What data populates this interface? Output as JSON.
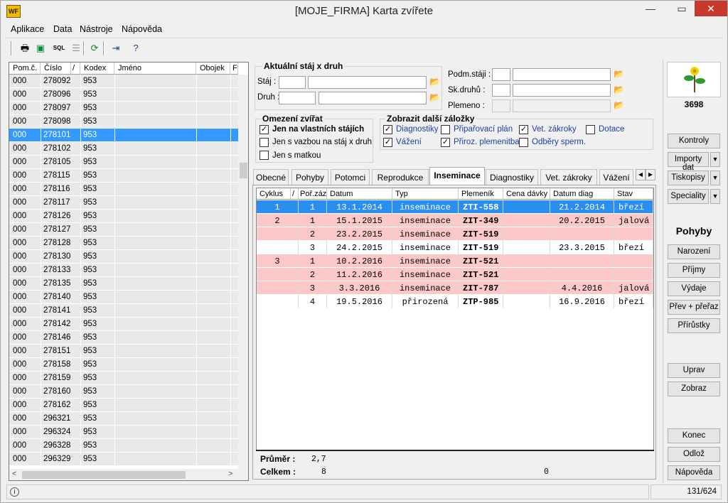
{
  "window": {
    "title": "[MOJE_FIRMA] Karta zvířete",
    "icon_text": "WF"
  },
  "menu": [
    "Aplikace",
    "Data",
    "Nástroje",
    "Nápověda"
  ],
  "toolbar": {
    "icons": [
      "printer-icon",
      "export-icon",
      "sql-icon",
      "columns-icon",
      "refresh-icon",
      "exit-icon",
      "help-icon"
    ],
    "sql_label": "SQL"
  },
  "left_grid": {
    "headers": [
      "Pom.č.",
      "Číslo",
      "/",
      "Kodex",
      "Jméno",
      "Obojek",
      "F"
    ],
    "rows": [
      [
        "000",
        "278092",
        "953"
      ],
      [
        "000",
        "278096",
        "953"
      ],
      [
        "000",
        "278097",
        "953"
      ],
      [
        "000",
        "278098",
        "953"
      ],
      [
        "000",
        "278101",
        "953"
      ],
      [
        "000",
        "278102",
        "953"
      ],
      [
        "000",
        "278105",
        "953"
      ],
      [
        "000",
        "278115",
        "953"
      ],
      [
        "000",
        "278116",
        "953"
      ],
      [
        "000",
        "278117",
        "953"
      ],
      [
        "000",
        "278126",
        "953"
      ],
      [
        "000",
        "278127",
        "953"
      ],
      [
        "000",
        "278128",
        "953"
      ],
      [
        "000",
        "278130",
        "953"
      ],
      [
        "000",
        "278133",
        "953"
      ],
      [
        "000",
        "278135",
        "953"
      ],
      [
        "000",
        "278140",
        "953"
      ],
      [
        "000",
        "278141",
        "953"
      ],
      [
        "000",
        "278142",
        "953"
      ],
      [
        "000",
        "278146",
        "953"
      ],
      [
        "000",
        "278151",
        "953"
      ],
      [
        "000",
        "278158",
        "953"
      ],
      [
        "000",
        "278159",
        "953"
      ],
      [
        "000",
        "278160",
        "953"
      ],
      [
        "000",
        "278162",
        "953"
      ],
      [
        "000",
        "296321",
        "953"
      ],
      [
        "000",
        "296324",
        "953"
      ],
      [
        "000",
        "296328",
        "953"
      ],
      [
        "000",
        "296329",
        "953"
      ]
    ],
    "selected_index": 4
  },
  "filters": {
    "group_title": "Aktuální stáj x druh",
    "staj_label": "Stáj :",
    "druh_label": "Druh :",
    "podm_label": "Podm.stáji :",
    "skdruhu_label": "Sk.druhů :",
    "plemeno_label": "Plemeno :"
  },
  "omezeni": {
    "title": "Omezení zvířat",
    "items": [
      {
        "label": "Jen na vlastních stájích",
        "checked": true
      },
      {
        "label": "Jen s vazbou na stáj x druh",
        "checked": false
      },
      {
        "label": "Jen s matkou",
        "checked": false
      }
    ]
  },
  "zalozky": {
    "title": "Zobrazit další záložky",
    "items": [
      {
        "label": "Diagnostiky",
        "checked": true
      },
      {
        "label": "Připařovací plán",
        "checked": false
      },
      {
        "label": "Vet. zákroky",
        "checked": true
      },
      {
        "label": "Dotace",
        "checked": false
      },
      {
        "label": "Vážení",
        "checked": true
      },
      {
        "label": "Přiroz. plemenitba",
        "checked": true
      },
      {
        "label": "Odběry sperm.",
        "checked": false
      }
    ]
  },
  "tabs": [
    "Obecné",
    "Pohyby",
    "Potomci",
    "Reprodukce",
    "Inseminace",
    "Diagnostiky",
    "Vet. zákroky",
    "Vážení"
  ],
  "active_tab": "Inseminace",
  "ins_grid": {
    "headers": [
      "Cyklus",
      "/",
      "Poř.záz",
      "Datum",
      "Typ",
      "Plemeník",
      "Cena dávky",
      "Datum diag",
      "Stav"
    ],
    "rows": [
      {
        "cyklus": "1",
        "por": "1",
        "datum": "13.1.2014",
        "typ": "inseminace",
        "plemenik": "ZTI-558",
        "cena": "",
        "diag": "21.2.2014",
        "stav": "březí",
        "style": "sel"
      },
      {
        "cyklus": "2",
        "por": "1",
        "datum": "15.1.2015",
        "typ": "inseminace",
        "plemenik": "ZIT-349",
        "cena": "",
        "diag": "20.2.2015",
        "stav": "jalová",
        "style": "pink"
      },
      {
        "cyklus": "",
        "por": "2",
        "datum": "23.2.2015",
        "typ": "inseminace",
        "plemenik": "ZIT-519",
        "cena": "",
        "diag": "",
        "stav": "",
        "style": "pink"
      },
      {
        "cyklus": "",
        "por": "3",
        "datum": "24.2.2015",
        "typ": "inseminace",
        "plemenik": "ZIT-519",
        "cena": "",
        "diag": "23.3.2015",
        "stav": "březí",
        "style": "white"
      },
      {
        "cyklus": "3",
        "por": "1",
        "datum": "10.2.2016",
        "typ": "inseminace",
        "plemenik": "ZIT-521",
        "cena": "",
        "diag": "",
        "stav": "",
        "style": "pink"
      },
      {
        "cyklus": "",
        "por": "2",
        "datum": "11.2.2016",
        "typ": "inseminace",
        "plemenik": "ZIT-521",
        "cena": "",
        "diag": "",
        "stav": "",
        "style": "pink"
      },
      {
        "cyklus": "",
        "por": "3",
        "datum": "3.3.2016",
        "typ": "inseminace",
        "plemenik": "ZIT-787",
        "cena": "",
        "diag": "4.4.2016",
        "stav": "jalová",
        "style": "pink"
      },
      {
        "cyklus": "",
        "por": "4",
        "datum": "19.5.2016",
        "typ": "přirozená",
        "plemenik": "ZTP-985",
        "cena": "",
        "diag": "16.9.2016",
        "stav": "březí",
        "style": "white"
      }
    ],
    "footer": {
      "prumer_label": "Průměr :",
      "prumer_value": "2,7",
      "celkem_label": "Celkem :",
      "celkem_value": "8",
      "cena_total": "0"
    }
  },
  "right": {
    "logo_number": "3698",
    "buttons_top": [
      "Kontroly",
      "Importy dat",
      "Tiskopisy",
      "Speciality"
    ],
    "section_title": "Pohyby",
    "pohyby": [
      "Narození",
      "Příjmy",
      "Výdaje",
      "Přev + přeřaz",
      "Přírůstky"
    ],
    "edit": [
      "Uprav",
      "Zobraz"
    ],
    "bottom": [
      "Konec",
      "Odlož",
      "Nápověda"
    ]
  },
  "status": {
    "counter": "131/624"
  }
}
